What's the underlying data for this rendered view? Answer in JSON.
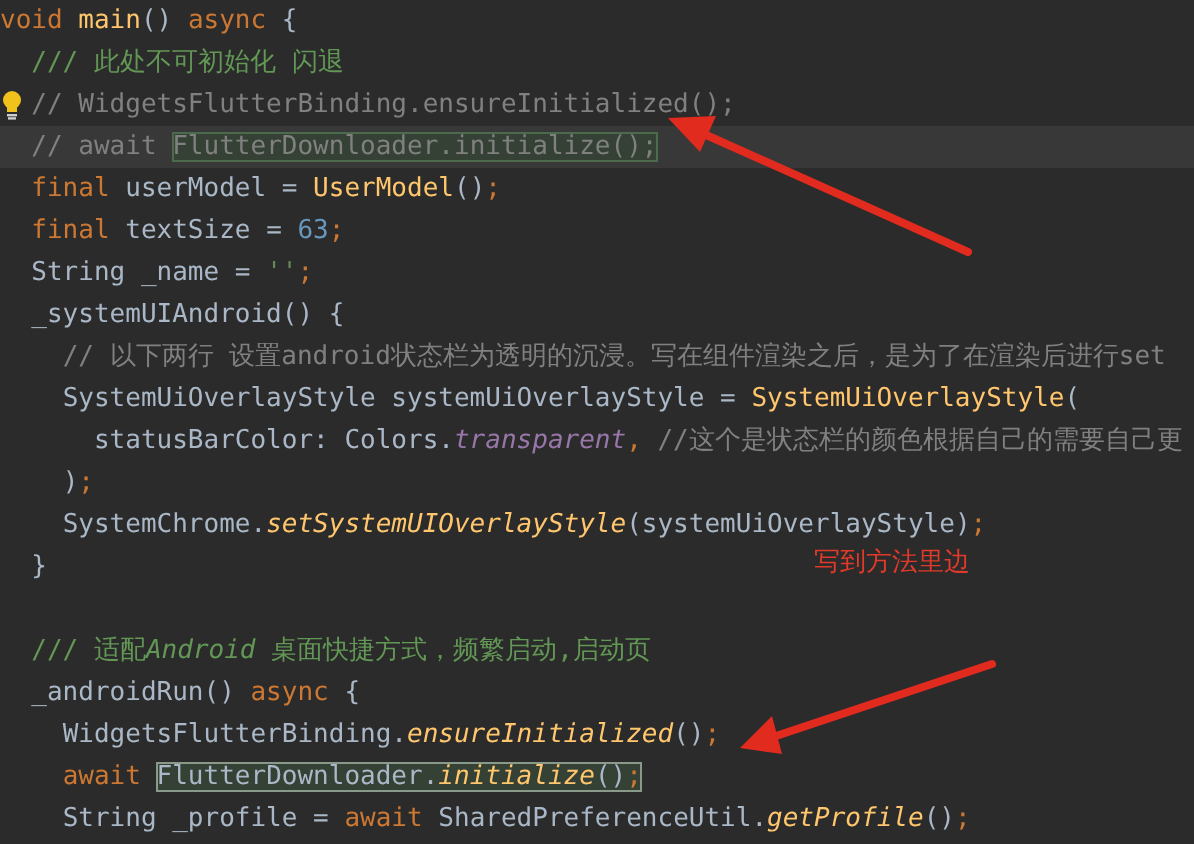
{
  "editor": {
    "lines": [
      {
        "current": false,
        "bulb": false,
        "tokens": [
          {
            "kind": "keyword",
            "text": "void",
            "highlighted": false
          },
          {
            "kind": "method",
            "text": " main",
            "highlighted": false
          },
          {
            "kind": "plain",
            "text": "() ",
            "highlighted": false
          },
          {
            "kind": "keyword",
            "text": "async",
            "highlighted": false
          },
          {
            "kind": "plain",
            "text": " {",
            "highlighted": false
          }
        ]
      },
      {
        "current": false,
        "bulb": false,
        "tokens": [
          {
            "kind": "doc",
            "text": "  /// 此处不可初始化 闪退",
            "highlighted": false
          }
        ]
      },
      {
        "current": false,
        "bulb": true,
        "tokens": [
          {
            "kind": "comment",
            "text": "  // WidgetsFlutterBinding.ensureInitialized();",
            "highlighted": false
          }
        ]
      },
      {
        "current": true,
        "bulb": false,
        "tokens": [
          {
            "kind": "comment",
            "text": "  // await ",
            "highlighted": false
          },
          {
            "kind": "comment",
            "text": "FlutterDownloader.initialize();",
            "highlighted": true
          }
        ]
      },
      {
        "current": false,
        "bulb": false,
        "tokens": [
          {
            "kind": "keyword",
            "text": "  final",
            "highlighted": false
          },
          {
            "kind": "plain",
            "text": " userModel = ",
            "highlighted": false
          },
          {
            "kind": "class",
            "text": "UserModel",
            "highlighted": false
          },
          {
            "kind": "plain",
            "text": "()",
            "highlighted": false
          },
          {
            "kind": "keyword",
            "text": ";",
            "highlighted": false
          }
        ]
      },
      {
        "current": false,
        "bulb": false,
        "tokens": [
          {
            "kind": "keyword",
            "text": "  final",
            "highlighted": false
          },
          {
            "kind": "plain",
            "text": " textSize = ",
            "highlighted": false
          },
          {
            "kind": "number",
            "text": "63",
            "highlighted": false
          },
          {
            "kind": "keyword",
            "text": ";",
            "highlighted": false
          }
        ]
      },
      {
        "current": false,
        "bulb": false,
        "tokens": [
          {
            "kind": "plain",
            "text": "  String _name = ",
            "highlighted": false
          },
          {
            "kind": "string",
            "text": "''",
            "highlighted": false
          },
          {
            "kind": "keyword",
            "text": ";",
            "highlighted": false
          }
        ]
      },
      {
        "current": false,
        "bulb": false,
        "tokens": [
          {
            "kind": "plain",
            "text": "  _systemUIAndroid() {",
            "highlighted": false
          }
        ]
      },
      {
        "current": false,
        "bulb": false,
        "tokens": [
          {
            "kind": "comment",
            "text": "    // 以下两行 设置android状态栏为透明的沉浸。写在组件渲染之后，是为了在渲染后进行set",
            "highlighted": false
          }
        ]
      },
      {
        "current": false,
        "bulb": false,
        "tokens": [
          {
            "kind": "plain",
            "text": "    SystemUiOverlayStyle systemUiOverlayStyle = ",
            "highlighted": false
          },
          {
            "kind": "class",
            "text": "SystemUiOverlayStyle",
            "highlighted": false
          },
          {
            "kind": "plain",
            "text": "(",
            "highlighted": false
          }
        ]
      },
      {
        "current": false,
        "bulb": false,
        "tokens": [
          {
            "kind": "plain",
            "text": "      statusBarColor: Colors.",
            "highlighted": false
          },
          {
            "kind": "field",
            "text": "transparent",
            "highlighted": false
          },
          {
            "kind": "keyword",
            "text": ",",
            "highlighted": false
          },
          {
            "kind": "comment",
            "text": " //这个是状态栏的颜色根据自己的需要自己更",
            "highlighted": false
          }
        ]
      },
      {
        "current": false,
        "bulb": false,
        "tokens": [
          {
            "kind": "plain",
            "text": "    )",
            "highlighted": false
          },
          {
            "kind": "keyword",
            "text": ";",
            "highlighted": false
          }
        ]
      },
      {
        "current": false,
        "bulb": false,
        "tokens": [
          {
            "kind": "plain",
            "text": "    SystemChrome.",
            "highlighted": false
          },
          {
            "kind": "call",
            "text": "setSystemUIOverlayStyle",
            "highlighted": false
          },
          {
            "kind": "plain",
            "text": "(systemUiOverlayStyle)",
            "highlighted": false
          },
          {
            "kind": "keyword",
            "text": ";",
            "highlighted": false
          }
        ]
      },
      {
        "current": false,
        "bulb": false,
        "tokens": [
          {
            "kind": "plain",
            "text": "  }",
            "highlighted": false
          }
        ]
      },
      {
        "current": false,
        "bulb": false
      },
      {
        "current": false,
        "bulb": false,
        "tokens": [
          {
            "kind": "doc",
            "text": "  /// 适配",
            "highlighted": false
          },
          {
            "kind": "doc-italic",
            "text": "Android",
            "highlighted": false
          },
          {
            "kind": "doc",
            "text": " 桌面快捷方式，频繁启动,启动页",
            "highlighted": false
          }
        ]
      },
      {
        "current": false,
        "bulb": false,
        "tokens": [
          {
            "kind": "plain",
            "text": "  _androidRun() ",
            "highlighted": false
          },
          {
            "kind": "keyword",
            "text": "async",
            "highlighted": false
          },
          {
            "kind": "plain",
            "text": " {",
            "highlighted": false
          }
        ]
      },
      {
        "current": false,
        "bulb": false,
        "tokens": [
          {
            "kind": "plain",
            "text": "    WidgetsFlutterBinding.",
            "highlighted": false
          },
          {
            "kind": "call",
            "text": "ensureInitialized",
            "highlighted": false
          },
          {
            "kind": "plain",
            "text": "()",
            "highlighted": false
          },
          {
            "kind": "keyword",
            "text": ";",
            "highlighted": false
          }
        ]
      },
      {
        "current": false,
        "bulb": false,
        "tokens": [
          {
            "kind": "keyword",
            "text": "    await ",
            "highlighted": false
          },
          {
            "kind": "plain",
            "text": "FlutterDownloader.",
            "highlighted": true
          },
          {
            "kind": "call",
            "text": "initialize",
            "highlighted": true
          },
          {
            "kind": "plain",
            "text": "()",
            "highlighted": true
          },
          {
            "kind": "keyword",
            "text": ";",
            "highlighted": true
          }
        ]
      },
      {
        "current": false,
        "bulb": false,
        "tokens": [
          {
            "kind": "plain",
            "text": "    String _profile = ",
            "highlighted": false
          },
          {
            "kind": "keyword",
            "text": "await",
            "highlighted": false
          },
          {
            "kind": "plain",
            "text": " SharedPreferenceUtil.",
            "highlighted": false
          },
          {
            "kind": "call",
            "text": "getProfile",
            "highlighted": false
          },
          {
            "kind": "plain",
            "text": "()",
            "highlighted": false
          },
          {
            "kind": "keyword",
            "text": ";",
            "highlighted": false
          }
        ]
      }
    ]
  },
  "annotation": {
    "note": "写到方法里边"
  }
}
